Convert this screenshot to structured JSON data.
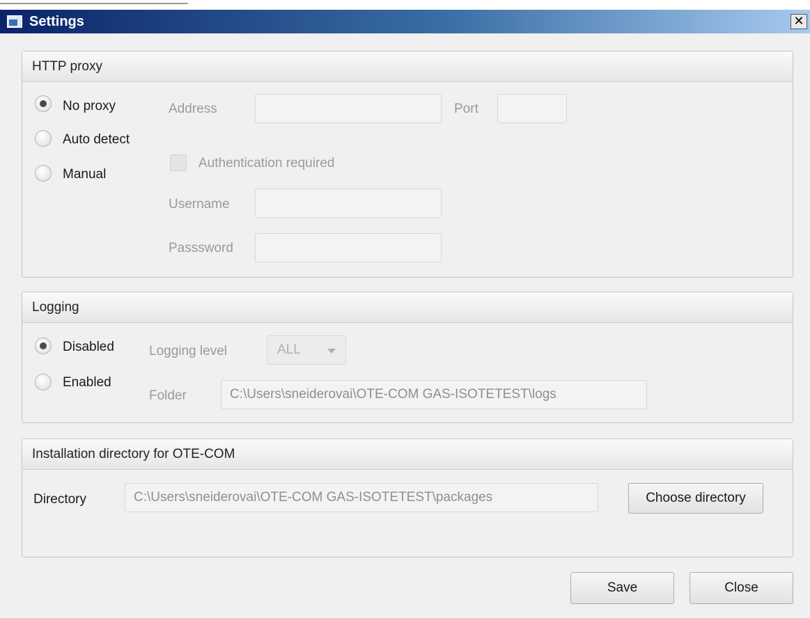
{
  "window": {
    "title": "Settings",
    "close_glyph": "✕",
    "icon": "settings-app-icon"
  },
  "http_proxy": {
    "heading": "HTTP proxy",
    "options": [
      "No proxy",
      "Auto detect",
      "Manual"
    ],
    "selected": "No proxy",
    "address_label": "Address",
    "address_value": "",
    "port_label": "Port",
    "port_value": "",
    "auth_label": "Authentication required",
    "auth_checked": false,
    "username_label": "Username",
    "username_value": "",
    "password_label": "Passsword",
    "password_value": ""
  },
  "logging": {
    "heading": "Logging",
    "options": [
      "Disabled",
      "Enabled"
    ],
    "selected": "Disabled",
    "level_label": "Logging level",
    "level_value": "ALL",
    "folder_label": "Folder",
    "folder_value": "C:\\Users\\sneiderovai\\OTE-COM GAS-ISOTETEST\\logs"
  },
  "installation": {
    "heading": "Installation directory for OTE-COM",
    "directory_label": "Directory",
    "directory_value": "C:\\Users\\sneiderovai\\OTE-COM GAS-ISOTETEST\\packages",
    "choose_button": "Choose directory"
  },
  "footer": {
    "save_button": "Save",
    "close_button": "Close"
  }
}
